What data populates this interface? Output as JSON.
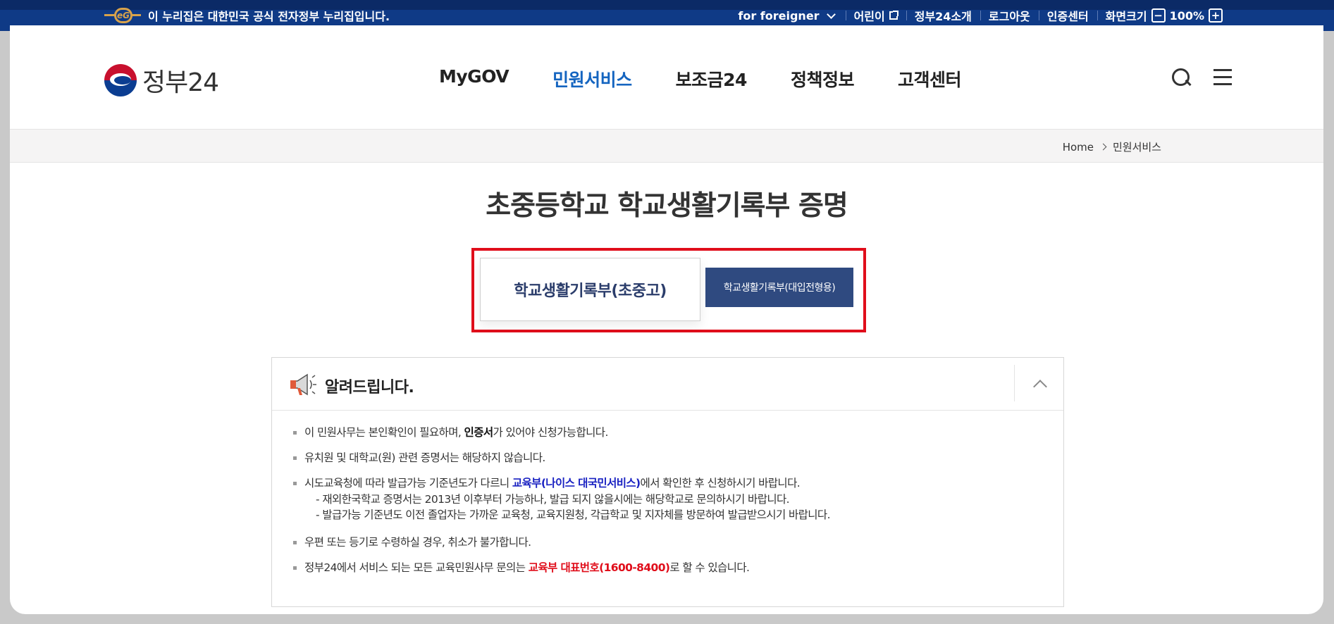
{
  "topbar": {
    "gov_notice": "이 누리집은 대한민국 공식 전자정부 누리집입니다.",
    "links": {
      "foreigner": "for foreigner",
      "kids": "어린이",
      "about": "정부24소개",
      "logout": "로그아웃",
      "cert": "인증센터",
      "screen_size": "화면크기"
    },
    "zoom": {
      "minus": "−",
      "value": "100%",
      "plus": "+"
    }
  },
  "header": {
    "logo_text": "정부24",
    "nav": [
      "MyGOV",
      "민원서비스",
      "보조금24",
      "정책정보",
      "고객센터"
    ],
    "active_nav": "민원서비스"
  },
  "breadcrumb": {
    "home": "Home",
    "current": "민원서비스"
  },
  "page_title": "초중등학교 학교생활기록부 증명",
  "tabs": {
    "tab1": "학교생활기록부(초중고)",
    "tab2": "학교생활기록부(대입전형용)"
  },
  "notice": {
    "title": "알려드립니다.",
    "items": {
      "i1": {
        "pre": "이 민원사무는 본인확인이 필요하며, ",
        "bold": "인증서",
        "post": "가 있어야 신청가능합니다."
      },
      "i2": {
        "text": "유치원 및 대학교(원) 관련 증명서는 해당하지 않습니다."
      },
      "i3": {
        "pre": "시도교육청에 따라 발급가능 기준년도가 다르니 ",
        "link": "교육부(나이스 대국민서비스)",
        "post": "에서 확인한 후 신청하시기 바랍니다.",
        "sub1": "- 재외한국학교 증명서는 2013년 이후부터 가능하나, 발급 되지 않을시에는 해당학교로 문의하시기 바랍니다.",
        "sub2": "- 발급가능 기준년도 이전 졸업자는 가까운 교육청, 교육지원청, 각급학교 및 지자체를 방문하여 발급받으시기 바랍니다."
      },
      "i4": {
        "text": "우편 또는 등기로 수령하실 경우, 취소가 불가합니다."
      },
      "i5": {
        "pre": "정부24에서 서비스 되는 모든 교육민원사무 문의는 ",
        "red": "교육부 대표번호(1600-8400)",
        "post": "로 할 수 있습니다."
      }
    }
  },
  "colors": {
    "brand_blue": "#0f3a86",
    "active_nav": "#1565c0",
    "highlight_red": "#e00e1b",
    "tab_dark": "#2f4a80"
  }
}
